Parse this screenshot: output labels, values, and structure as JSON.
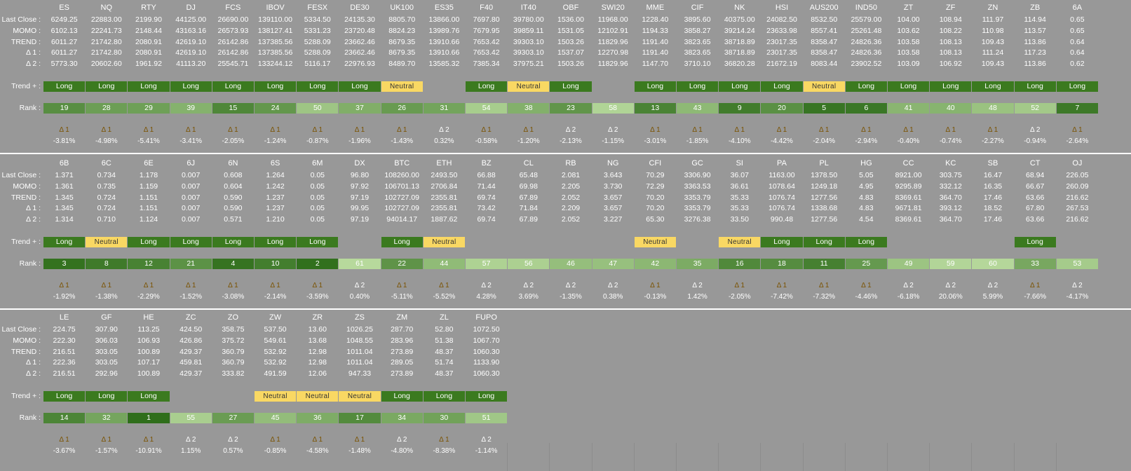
{
  "labels": {
    "last_close": "Last Close :",
    "momo": "MOMO :",
    "trend": "TREND :",
    "d1": "Δ 1 :",
    "d2": "Δ 2 :",
    "trend_plus": "Trend + :",
    "rank": "Rank :"
  },
  "colors": {
    "long": "#3b7a1f",
    "neutral": "#f9d863",
    "separator": "#ffffff",
    "background": "#989898"
  },
  "sections": [
    {
      "symbols": [
        "ES",
        "NQ",
        "RTY",
        "DJ",
        "FCS",
        "IBOV",
        "FESX",
        "DE30",
        "UK100",
        "ES35",
        "F40",
        "IT40",
        "OBF",
        "SWI20",
        "MME",
        "CIF",
        "NK",
        "HSI",
        "AUS200",
        "IND50",
        "ZT",
        "ZF",
        "ZN",
        "ZB",
        "6A"
      ],
      "last_close": [
        "6249.25",
        "22883.00",
        "2199.90",
        "44125.00",
        "26690.00",
        "139110.00",
        "5334.50",
        "24135.30",
        "8805.70",
        "13866.00",
        "7697.80",
        "39780.00",
        "1536.00",
        "11968.00",
        "1228.40",
        "3895.60",
        "40375.00",
        "24082.50",
        "8532.50",
        "25579.00",
        "104.00",
        "108.94",
        "111.97",
        "114.94",
        "0.65"
      ],
      "momo": [
        "6102.13",
        "22241.73",
        "2148.44",
        "43163.16",
        "26573.93",
        "138127.41",
        "5331.23",
        "23720.48",
        "8824.23",
        "13989.76",
        "7679.95",
        "39859.11",
        "1531.05",
        "12102.91",
        "1194.33",
        "3858.27",
        "39214.24",
        "23633.98",
        "8557.41",
        "25261.48",
        "103.62",
        "108.22",
        "110.98",
        "113.57",
        "0.65"
      ],
      "trend": [
        "6011.27",
        "21742.80",
        "2080.91",
        "42619.10",
        "26142.86",
        "137385.56",
        "5288.09",
        "23662.46",
        "8679.35",
        "13910.66",
        "7653.42",
        "39303.10",
        "1503.26",
        "11829.96",
        "1191.40",
        "3823.65",
        "38718.89",
        "23017.35",
        "8358.47",
        "24826.36",
        "103.58",
        "108.13",
        "109.43",
        "113.86",
        "0.64"
      ],
      "d1": [
        "6011.27",
        "21742.80",
        "2080.91",
        "42619.10",
        "26142.86",
        "137385.56",
        "5288.09",
        "23662.46",
        "8679.35",
        "13910.66",
        "7653.42",
        "39303.10",
        "1537.07",
        "12270.98",
        "1191.40",
        "3823.65",
        "38718.89",
        "23017.35",
        "8358.47",
        "24826.36",
        "103.58",
        "108.13",
        "111.24",
        "117.23",
        "0.64"
      ],
      "d2": [
        "5773.30",
        "20602.60",
        "1961.92",
        "41113.20",
        "25545.71",
        "133244.12",
        "5116.17",
        "22976.93",
        "8489.70",
        "13585.32",
        "7385.34",
        "37975.21",
        "1503.26",
        "11829.96",
        "1147.70",
        "3710.10",
        "36820.28",
        "21672.19",
        "8083.44",
        "23902.52",
        "103.09",
        "106.92",
        "109.43",
        "113.86",
        "0.62"
      ],
      "trend_plus": [
        "Long",
        "Long",
        "Long",
        "Long",
        "Long",
        "Long",
        "Long",
        "Long",
        "Neutral",
        "",
        "Long",
        "Neutral",
        "Long",
        "",
        "Long",
        "Long",
        "Long",
        "Long",
        "Neutral",
        "Long",
        "Long",
        "Long",
        "Long",
        "Long",
        "Long"
      ],
      "rank": [
        "19",
        "28",
        "29",
        "39",
        "15",
        "24",
        "50",
        "37",
        "26",
        "31",
        "54",
        "38",
        "23",
        "58",
        "13",
        "43",
        "9",
        "20",
        "5",
        "6",
        "41",
        "40",
        "48",
        "52",
        "7"
      ],
      "delta_label": [
        "Δ 1",
        "Δ 1",
        "Δ 1",
        "Δ 1",
        "Δ 1",
        "Δ 1",
        "Δ 1",
        "Δ 1",
        "Δ 1",
        "Δ 2",
        "Δ 1",
        "Δ 1",
        "Δ 2",
        "Δ 2",
        "Δ 1",
        "Δ 1",
        "Δ 1",
        "Δ 1",
        "Δ 1",
        "Δ 1",
        "Δ 1",
        "Δ 1",
        "Δ 1",
        "Δ 2",
        "Δ 1"
      ],
      "pct": [
        "-3.81%",
        "-4.98%",
        "-5.41%",
        "-3.41%",
        "-2.05%",
        "-1.24%",
        "-0.87%",
        "-1.96%",
        "-1.43%",
        "0.32%",
        "-0.58%",
        "-1.20%",
        "-2.13%",
        "-1.15%",
        "-3.01%",
        "-1.85%",
        "-4.10%",
        "-4.42%",
        "-2.04%",
        "-2.94%",
        "-0.40%",
        "-0.74%",
        "-2.27%",
        "-0.94%",
        "-2.64%"
      ]
    },
    {
      "symbols": [
        "6B",
        "6C",
        "6E",
        "6J",
        "6N",
        "6S",
        "6M",
        "DX",
        "BTC",
        "ETH",
        "BZ",
        "CL",
        "RB",
        "NG",
        "CFI",
        "GC",
        "SI",
        "PA",
        "PL",
        "HG",
        "CC",
        "KC",
        "SB",
        "CT",
        "OJ"
      ],
      "last_close": [
        "1.371",
        "0.734",
        "1.178",
        "0.007",
        "0.608",
        "1.264",
        "0.05",
        "96.80",
        "108260.00",
        "2493.50",
        "66.88",
        "65.48",
        "2.081",
        "3.643",
        "70.29",
        "3306.90",
        "36.07",
        "1163.00",
        "1378.50",
        "5.05",
        "8921.00",
        "303.75",
        "16.47",
        "68.94",
        "226.05"
      ],
      "momo": [
        "1.361",
        "0.735",
        "1.159",
        "0.007",
        "0.604",
        "1.242",
        "0.05",
        "97.92",
        "106701.13",
        "2706.84",
        "71.44",
        "69.98",
        "2.205",
        "3.730",
        "72.29",
        "3363.53",
        "36.61",
        "1078.64",
        "1249.18",
        "4.95",
        "9295.89",
        "332.12",
        "16.35",
        "66.67",
        "260.09"
      ],
      "trend": [
        "1.345",
        "0.724",
        "1.151",
        "0.007",
        "0.590",
        "1.237",
        "0.05",
        "97.19",
        "102727.09",
        "2355.81",
        "69.74",
        "67.89",
        "2.052",
        "3.657",
        "70.20",
        "3353.79",
        "35.33",
        "1076.74",
        "1277.56",
        "4.83",
        "8369.61",
        "364.70",
        "17.46",
        "63.66",
        "216.62"
      ],
      "d1": [
        "1.345",
        "0.724",
        "1.151",
        "0.007",
        "0.590",
        "1.237",
        "0.05",
        "99.95",
        "102727.09",
        "2355.81",
        "73.42",
        "71.84",
        "2.209",
        "3.657",
        "70.20",
        "3353.79",
        "35.33",
        "1076.74",
        "1338.68",
        "4.83",
        "9671.81",
        "393.12",
        "18.52",
        "67.80",
        "267.53"
      ],
      "d2": [
        "1.314",
        "0.710",
        "1.124",
        "0.007",
        "0.571",
        "1.210",
        "0.05",
        "97.19",
        "94014.17",
        "1887.62",
        "69.74",
        "67.89",
        "2.052",
        "3.227",
        "65.30",
        "3276.38",
        "33.50",
        "990.48",
        "1277.56",
        "4.54",
        "8369.61",
        "364.70",
        "17.46",
        "63.66",
        "216.62"
      ],
      "trend_plus": [
        "Long",
        "Neutral",
        "Long",
        "Long",
        "Long",
        "Long",
        "Long",
        "",
        "Long",
        "Neutral",
        "",
        "",
        "",
        "",
        "Neutral",
        "",
        "Neutral",
        "Long",
        "Long",
        "Long",
        "",
        "",
        "",
        "Long",
        ""
      ],
      "rank": [
        "3",
        "8",
        "12",
        "21",
        "4",
        "10",
        "2",
        "61",
        "22",
        "44",
        "57",
        "56",
        "46",
        "47",
        "42",
        "35",
        "16",
        "18",
        "11",
        "25",
        "49",
        "59",
        "60",
        "33",
        "53"
      ],
      "delta_label": [
        "Δ 1",
        "Δ 1",
        "Δ 1",
        "Δ 1",
        "Δ 1",
        "Δ 1",
        "Δ 1",
        "Δ 2",
        "Δ 1",
        "Δ 1",
        "Δ 2",
        "Δ 2",
        "Δ 2",
        "Δ 2",
        "Δ 1",
        "Δ 2",
        "Δ 1",
        "Δ 1",
        "Δ 1",
        "Δ 1",
        "Δ 2",
        "Δ 2",
        "Δ 2",
        "Δ 1",
        "Δ 2"
      ],
      "pct": [
        "-1.92%",
        "-1.38%",
        "-2.29%",
        "-1.52%",
        "-3.08%",
        "-2.14%",
        "-3.59%",
        "0.40%",
        "-5.11%",
        "-5.52%",
        "4.28%",
        "3.69%",
        "-1.35%",
        "0.38%",
        "-0.13%",
        "1.42%",
        "-2.05%",
        "-7.42%",
        "-7.32%",
        "-4.46%",
        "-6.18%",
        "20.06%",
        "5.99%",
        "-7.66%",
        "-4.17%"
      ]
    },
    {
      "symbols": [
        "LE",
        "GF",
        "HE",
        "ZC",
        "ZO",
        "ZW",
        "ZR",
        "ZS",
        "ZM",
        "ZL",
        "FUPO"
      ],
      "last_close": [
        "224.75",
        "307.90",
        "113.25",
        "424.50",
        "358.75",
        "537.50",
        "13.60",
        "1026.25",
        "287.70",
        "52.80",
        "1072.50"
      ],
      "momo": [
        "222.30",
        "306.03",
        "106.93",
        "426.86",
        "375.72",
        "549.61",
        "13.68",
        "1048.55",
        "283.96",
        "51.38",
        "1067.70"
      ],
      "trend": [
        "216.51",
        "303.05",
        "100.89",
        "429.37",
        "360.79",
        "532.92",
        "12.98",
        "1011.04",
        "273.89",
        "48.37",
        "1060.30"
      ],
      "d1": [
        "222.36",
        "303.05",
        "107.17",
        "459.81",
        "360.79",
        "532.92",
        "12.98",
        "1011.04",
        "289.05",
        "51.74",
        "1133.90"
      ],
      "d2": [
        "216.51",
        "292.96",
        "100.89",
        "429.37",
        "333.82",
        "491.59",
        "12.06",
        "947.33",
        "273.89",
        "48.37",
        "1060.30"
      ],
      "trend_plus": [
        "Long",
        "Long",
        "Long",
        "",
        "",
        "Neutral",
        "Neutral",
        "Neutral",
        "Long",
        "Long",
        "Long"
      ],
      "rank": [
        "14",
        "32",
        "1",
        "55",
        "27",
        "45",
        "36",
        "17",
        "34",
        "30",
        "51"
      ],
      "delta_label": [
        "Δ 1",
        "Δ 1",
        "Δ 1",
        "Δ 2",
        "Δ 2",
        "Δ 1",
        "Δ 1",
        "Δ 1",
        "Δ 2",
        "Δ 1",
        "Δ 2"
      ],
      "pct": [
        "-3.67%",
        "-1.57%",
        "-10.91%",
        "1.15%",
        "0.57%",
        "-0.85%",
        "-4.58%",
        "-1.48%",
        "-4.80%",
        "-8.38%",
        "-1.14%"
      ]
    }
  ]
}
